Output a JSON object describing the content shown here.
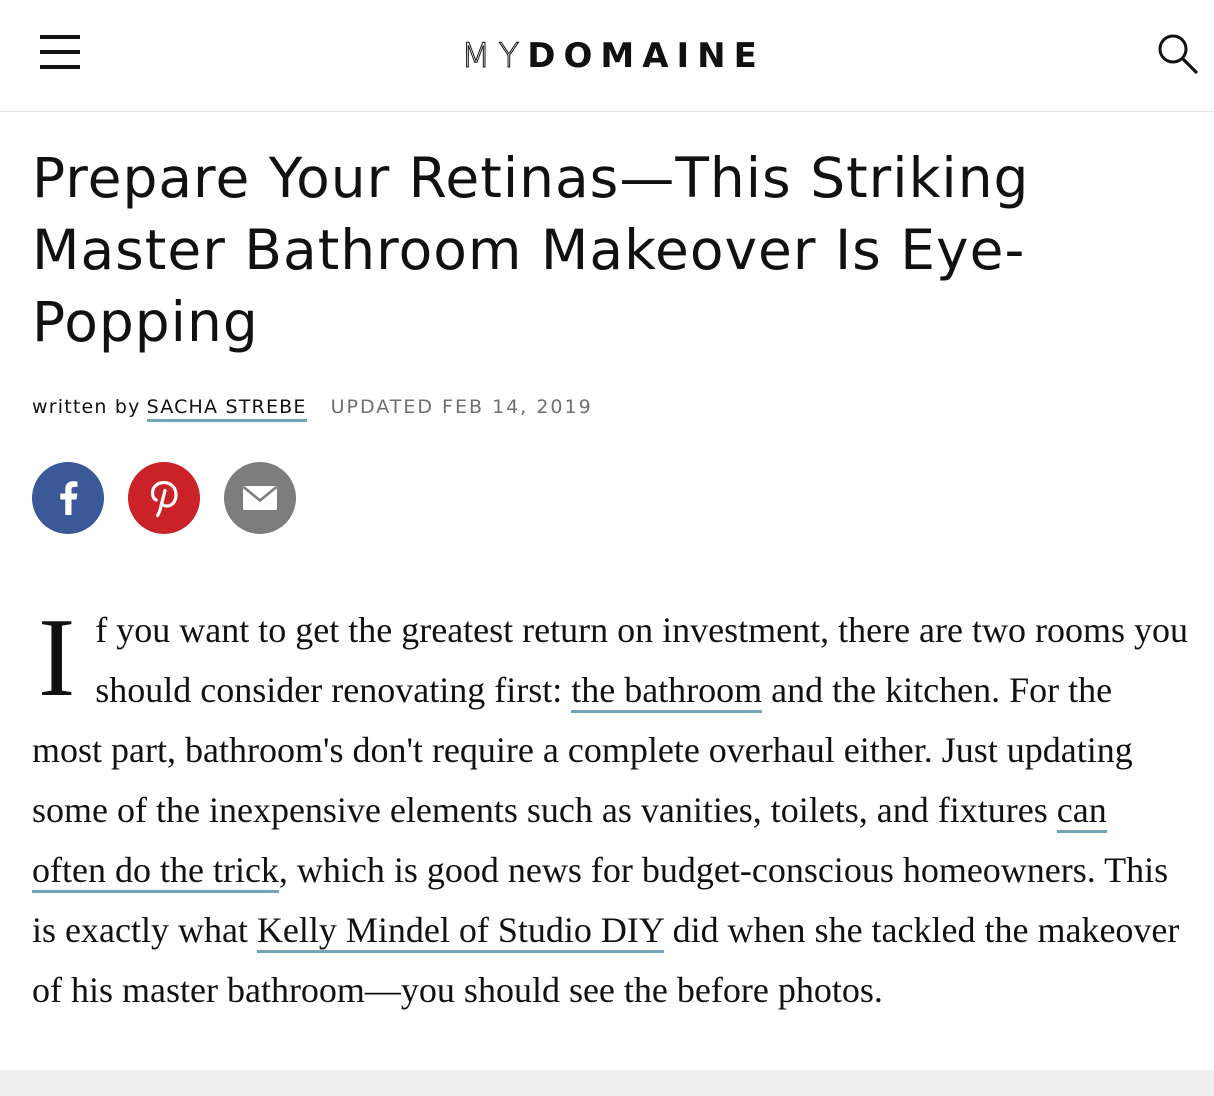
{
  "header": {
    "logo_light": "MY",
    "logo_bold": "DOMAINE",
    "menu_icon": "hamburger-menu-icon",
    "search_icon": "search-icon"
  },
  "article": {
    "headline": "Prepare Your Retinas—This Striking Master Bathroom Makeover Is Eye-Popping",
    "byline": {
      "written_by": "written by",
      "author": "SACHA STREBE",
      "updated": "UPDATED FEB 14, 2019"
    },
    "share": [
      {
        "name": "facebook",
        "icon": "facebook-icon",
        "color": "#3b5998"
      },
      {
        "name": "pinterest",
        "icon": "pinterest-icon",
        "color": "#cb2129"
      },
      {
        "name": "email",
        "icon": "email-icon",
        "color": "#7d7d7d"
      }
    ],
    "body": {
      "dropcap": "I",
      "text_1": "f you want to get the greatest return on investment, there are two rooms you should consider renovating first: ",
      "link_1": "the bathroom",
      "text_2": " and the kitchen. For the most part, bathroom's don't require a complete overhaul either. Just updating some of the inexpensive elements such as vanities, toilets, and fixtures ",
      "link_2": "can often do the trick",
      "text_3": ", which is good news for budget-conscious homeowners. This is exactly what ",
      "link_3": "Kelly Mindel of Studio DIY",
      "text_4": " did when she tackled the makeover of his master bathroom—you should see the before photos."
    }
  },
  "colors": {
    "link_underline": "#74a5b7",
    "updated_text": "#6f6f6f"
  }
}
